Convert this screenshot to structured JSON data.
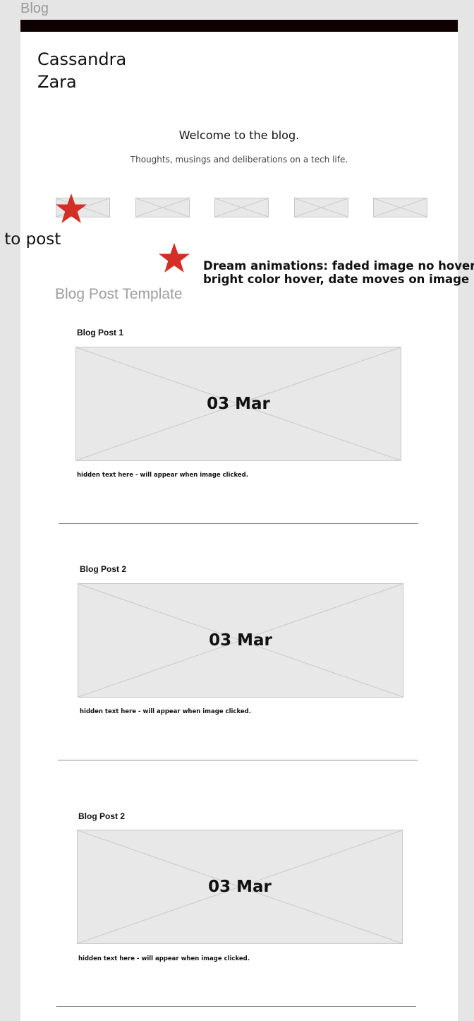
{
  "frame": {
    "label": "Blog"
  },
  "header": {
    "site_title_line1": "Cassandra",
    "site_title_line2": "Zara"
  },
  "intro": {
    "welcome": "Welcome to the blog.",
    "tagline": "Thoughts, musings and deliberations on a tech life."
  },
  "annotations": {
    "link_note": "nk to post",
    "dream_line1": "Dream animations:  faded image no hover",
    "dream_line2": "bright color hover, date moves on image",
    "star_color": "#d42f27"
  },
  "template": {
    "label": "Blog Post Template"
  },
  "posts": [
    {
      "title": "Blog Post 1",
      "date": "03 Mar",
      "hidden": "hidden text here - will appear when image clicked."
    },
    {
      "title": "Blog Post 2",
      "date": "03 Mar",
      "hidden": "hidden text here - will appear when image clicked."
    },
    {
      "title": "Blog Post 2",
      "date": "03 Mar",
      "hidden": "hidden text here - will appear when image clicked."
    }
  ],
  "colors": {
    "topbar": "#0e0000",
    "placeholder_fill": "#e8e8e8",
    "placeholder_stroke": "#c8c8c8"
  }
}
